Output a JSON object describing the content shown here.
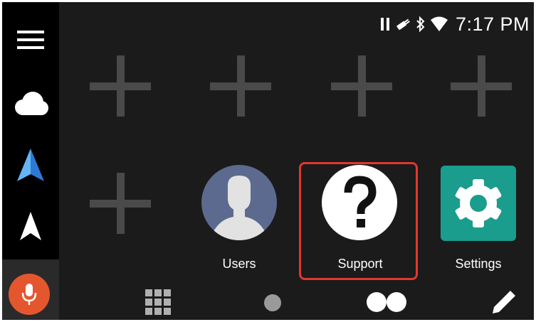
{
  "status_bar": {
    "time": "7:17 PM",
    "icons": [
      "pause-icon",
      "usb-plug-icon",
      "bluetooth-icon",
      "wifi-icon"
    ]
  },
  "sidebar": {
    "items": [
      "menu-icon",
      "cloud-icon",
      "android-auto-navigation-icon",
      "navigation-arrow-icon"
    ],
    "mic": {
      "icon": "microphone-icon",
      "color": "#e4572e"
    }
  },
  "home_grid": {
    "empty_slot_icon": "add-plus-icon",
    "apps": [
      {
        "label": "Users",
        "icon": "user-avatar-icon",
        "color": "#5d6a8f"
      },
      {
        "label": "Support",
        "icon": "question-mark-icon",
        "color": "#ffffff",
        "selected": true
      },
      {
        "label": "Settings",
        "icon": "gear-icon",
        "color": "#1a9d8c"
      }
    ]
  },
  "dock": {
    "items": [
      "app-grid-icon",
      "page-indicator-dot",
      "dual-dots-icon",
      "edit-pencil-icon"
    ]
  },
  "colors": {
    "background": "#1b1b1b",
    "sidebar": "#000000",
    "highlight": "#e2372e",
    "plus": "#4a4a4a"
  }
}
